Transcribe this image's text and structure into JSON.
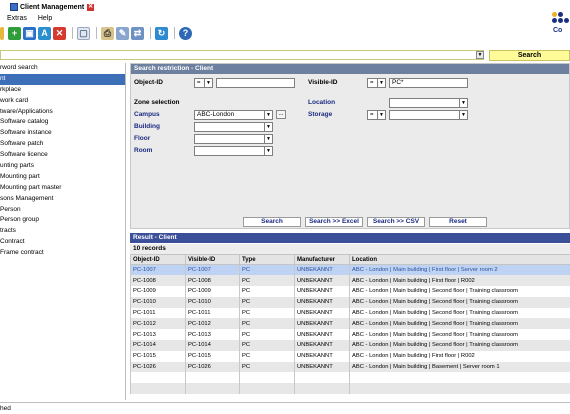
{
  "window": {
    "title": "Client Management"
  },
  "menu": {
    "items": [
      "Extras",
      "Help"
    ]
  },
  "logo": {
    "text": "Co"
  },
  "top_search": {
    "button_label": "Search"
  },
  "sidebar": {
    "items": [
      "rword search",
      "nt",
      "rkplace",
      "work card",
      "tware/Applications",
      "Software catalog",
      "Software instance",
      "Software patch",
      "Software licence",
      "unting parts",
      "Mounting part",
      "Mounting part master",
      "sons Management",
      "Person",
      "Person group",
      "tracts",
      "Contract",
      "Frame contract"
    ],
    "selected_index": 1
  },
  "search_panel": {
    "title": "Search restriction - Client",
    "object_id_label": "Object-ID",
    "object_id_op": "=",
    "object_id_value": "",
    "visible_id_label": "Visible-ID",
    "visible_id_op": "=",
    "visible_id_value": "PC*",
    "zone_label": "Zone selection",
    "campus_label": "Campus",
    "campus_value": "ABC-London",
    "building_label": "Building",
    "floor_label": "Floor",
    "room_label": "Room",
    "location_label": "Location",
    "storage_label": "Storage",
    "storage_op": "=",
    "ellipsis": "..."
  },
  "actions": {
    "search": "Search",
    "search_excel": "Search >> Excel",
    "search_csv": "Search >> CSV",
    "reset": "Reset"
  },
  "results": {
    "title": "Result - Client",
    "count": "10 records",
    "columns": [
      "Object-ID",
      "Visible-ID",
      "Type",
      "Manufacturer",
      "Location"
    ],
    "rows": [
      [
        "PC-1007",
        "PC-1007",
        "PC",
        "UNBEKANNT",
        "ABC - London | Main building | First floor | Server room 2"
      ],
      [
        "PC-1008",
        "PC-1008",
        "PC",
        "UNBEKANNT",
        "ABC - London | Main building | First floor | R002"
      ],
      [
        "PC-1009",
        "PC-1009",
        "PC",
        "UNBEKANNT",
        "ABC - London | Main building | Second floor | Training classroom"
      ],
      [
        "PC-1010",
        "PC-1010",
        "PC",
        "UNBEKANNT",
        "ABC - London | Main building | Second floor | Training classroom"
      ],
      [
        "PC-1011",
        "PC-1011",
        "PC",
        "UNBEKANNT",
        "ABC - London | Main building | Second floor | Training classroom"
      ],
      [
        "PC-1012",
        "PC-1012",
        "PC",
        "UNBEKANNT",
        "ABC - London | Main building | Second floor | Training classroom"
      ],
      [
        "PC-1013",
        "PC-1013",
        "PC",
        "UNBEKANNT",
        "ABC - London | Main building | Second floor | Training classroom"
      ],
      [
        "PC-1014",
        "PC-1014",
        "PC",
        "UNBEKANNT",
        "ABC - London | Main building | Second floor | Training classroom"
      ],
      [
        "PC-1015",
        "PC-1015",
        "PC",
        "UNBEKANNT",
        "ABC - London | Main building | First floor | R002"
      ],
      [
        "PC-1026",
        "PC-1026",
        "PC",
        "UNBEKANNT",
        "ABC - London | Main building | Basement | Server room 1"
      ]
    ],
    "selected_index": 0
  },
  "status": {
    "text": "hed"
  },
  "colors": {
    "selected_nav": "#3c6fb8",
    "panel_header": "#6d80a0",
    "result_header": "#3c4f99",
    "selected_row": "#bed3f3",
    "search_button": "#fffb99"
  }
}
